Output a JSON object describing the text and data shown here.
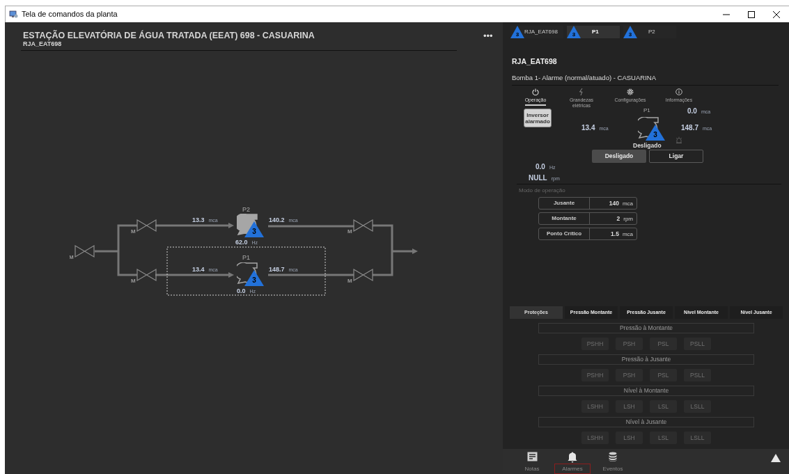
{
  "window": {
    "title": "Tela de comandos da planta"
  },
  "header": {
    "title": "ESTAÇÃO ELEVATÓRIA DE ÁGUA TRATADA (EEAT) 698 - CASUARINA",
    "subtitle": "RJA_EAT698",
    "menu": "•••"
  },
  "diagram": {
    "inlet_valve": {
      "label": "M"
    },
    "branches": [
      {
        "pump": "P2",
        "running": true,
        "selected": false,
        "badge": "3",
        "suction": {
          "value": "13.3",
          "unit": "mca"
        },
        "discharge": {
          "value": "140.2",
          "unit": "mca"
        },
        "frequency": {
          "value": "62.0",
          "unit": "Hz"
        },
        "valves": [
          {
            "label": "M"
          },
          {
            "label": "M"
          }
        ]
      },
      {
        "pump": "P1",
        "running": false,
        "selected": true,
        "badge": "3",
        "suction": {
          "value": "13.4",
          "unit": "mca"
        },
        "discharge": {
          "value": "148.7",
          "unit": "mca"
        },
        "frequency": {
          "value": "0.0",
          "unit": "Hz"
        },
        "valves": [
          {
            "label": "M"
          },
          {
            "label": "M"
          }
        ]
      }
    ]
  },
  "panel": {
    "tabs": [
      {
        "label": "RJA_EAT698",
        "badge": "3",
        "selected": false
      },
      {
        "label": "P1",
        "badge": "3",
        "selected": true
      },
      {
        "label": "P2",
        "badge": "3",
        "selected": false
      }
    ],
    "title": "RJA_EAT698",
    "subtitle": "Bomba 1- Alarme (normal/atuado) - CASUARINA",
    "sections": [
      {
        "kind": "power",
        "label": "Operação",
        "selected": true
      },
      {
        "kind": "bolt",
        "label": "Grandezas elétricas",
        "selected": false
      },
      {
        "kind": "gear",
        "label": "Configurações",
        "selected": false
      },
      {
        "kind": "info",
        "label": "Informações",
        "selected": false
      }
    ],
    "operation": {
      "alarm_button": "Inversor alarmado",
      "pump": {
        "label": "P1",
        "badge": "3",
        "running": false,
        "status": "Desligado"
      },
      "outlet_pressure": {
        "value": "0.0",
        "unit": "mca"
      },
      "suction": {
        "value": "13.4",
        "unit": "mca"
      },
      "discharge": {
        "value": "148.7",
        "unit": "mca"
      },
      "buttons": [
        {
          "label": "Desligado",
          "selected": true
        },
        {
          "label": "Ligar",
          "selected": false
        }
      ],
      "frequency": {
        "value": "0.0",
        "unit": "Hz"
      },
      "speed": {
        "value": "NULL",
        "unit": "rpm"
      }
    },
    "mode": {
      "title": "Modo de operação",
      "rows": [
        {
          "label": "Jusante",
          "value": "140",
          "unit": "mca"
        },
        {
          "label": "Montante",
          "value": "2",
          "unit": "rpm"
        },
        {
          "label": "Ponto Crítico",
          "value": "1.5",
          "unit": "mca"
        }
      ]
    },
    "protection_tabs": [
      {
        "label": "Proteções",
        "selected": true
      },
      {
        "label": "Pressão Montante",
        "selected": false
      },
      {
        "label": "Pressão Jusante",
        "selected": false
      },
      {
        "label": "Nível Montante",
        "selected": false
      },
      {
        "label": "Nível Jusante",
        "selected": false
      }
    ],
    "protection_groups": [
      {
        "title": "Pressão à Montante",
        "flags": [
          {
            "label": "PSHH",
            "active": false
          },
          {
            "label": "PSH",
            "active": false
          },
          {
            "label": "PSL",
            "active": false
          },
          {
            "label": "PSLL",
            "active": false
          }
        ]
      },
      {
        "title": "Pressão à Jusante",
        "flags": [
          {
            "label": "PSHH",
            "active": false
          },
          {
            "label": "PSH",
            "active": false
          },
          {
            "label": "PSL",
            "active": false
          },
          {
            "label": "PSLL",
            "active": false
          }
        ]
      },
      {
        "title": "Nível à Montante",
        "flags": [
          {
            "label": "LSHH",
            "active": false
          },
          {
            "label": "LSH",
            "active": false
          },
          {
            "label": "LSL",
            "active": false
          },
          {
            "label": "LSLL",
            "active": false
          }
        ]
      },
      {
        "title": "Nível à Jusante",
        "flags": [
          {
            "label": "LSHH",
            "active": false
          },
          {
            "label": "LSH",
            "active": false
          },
          {
            "label": "LSL",
            "active": false
          },
          {
            "label": "LSLL",
            "active": false
          }
        ]
      }
    ]
  },
  "footer": {
    "items": [
      {
        "kind": "notes",
        "label": "Notas",
        "selected": false
      },
      {
        "kind": "bell",
        "label": "Alarmes",
        "selected": true
      },
      {
        "kind": "database",
        "label": "Eventos",
        "selected": false
      }
    ]
  }
}
